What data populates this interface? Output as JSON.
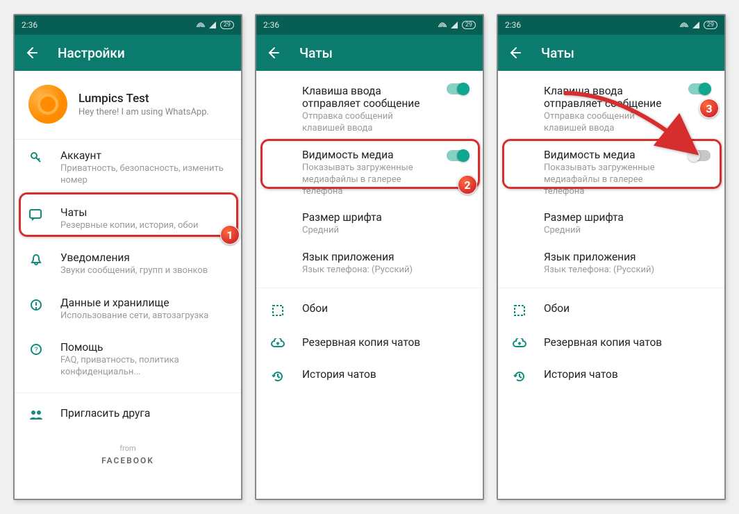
{
  "status": {
    "time": "2:36",
    "battery": "29"
  },
  "screen1": {
    "title": "Настройки",
    "profile": {
      "name": "Lumpics Test",
      "status": "Hey there! I am using WhatsApp."
    },
    "rows": {
      "account": {
        "title": "Аккаунт",
        "sub": "Приватность, безопасность, изменить номер"
      },
      "chats": {
        "title": "Чаты",
        "sub": "Резервные копии, история, обои"
      },
      "notify": {
        "title": "Уведомления",
        "sub": "Звуки сообщений, групп и звонков"
      },
      "data": {
        "title": "Данные и хранилище",
        "sub": "Использование сети, автозагрузка"
      },
      "help": {
        "title": "Помощь",
        "sub": "FAQ, приватность, политика конфиденциальн..."
      },
      "invite": {
        "title": "Пригласить друга"
      }
    },
    "from": "from",
    "facebook": "FACEBOOK"
  },
  "chatSettings": {
    "title": "Чаты",
    "enter": {
      "title": "Клавиша ввода отправляет сообщение",
      "sub": "Отправка сообщений клавишей ввода"
    },
    "media": {
      "title": "Видимость медиа",
      "sub": "Показывать загруженные медиафайлы в галерее телефона"
    },
    "font": {
      "title": "Размер шрифта",
      "sub": "Средний"
    },
    "lang": {
      "title": "Язык приложения",
      "sub": "Язык телефона: (Русский)"
    },
    "wallpaper": {
      "title": "Обои"
    },
    "backup": {
      "title": "Резервная копия чатов"
    },
    "history": {
      "title": "История чатов"
    }
  },
  "badges": {
    "b1": "1",
    "b2": "2",
    "b3": "3"
  }
}
